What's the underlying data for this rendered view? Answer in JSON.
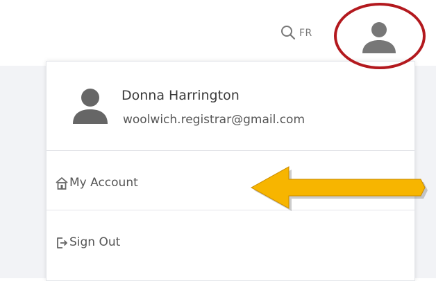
{
  "header": {
    "language_label": "FR"
  },
  "account_menu": {
    "user_name": "Donna Harrington",
    "user_email": "woolwich.registrar@gmail.com",
    "items": [
      {
        "label": "My Account",
        "icon": "home-icon"
      },
      {
        "label": "Sign Out",
        "icon": "sign-out-icon"
      }
    ]
  },
  "annotation": {
    "ring_color": "#b3191e",
    "arrow_color": "#f7b500"
  }
}
